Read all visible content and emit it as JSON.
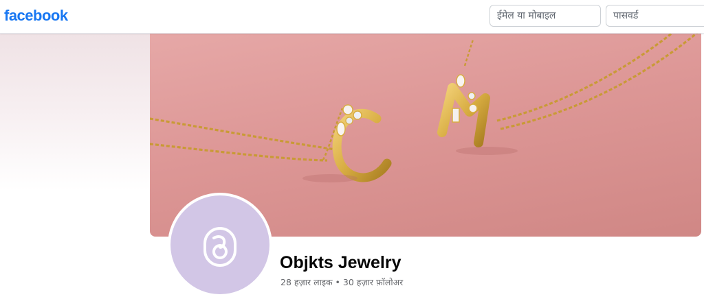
{
  "brand": {
    "logo_text": "facebook",
    "color": "#1877f2"
  },
  "login": {
    "email_placeholder": "ईमेल या मोबाइल",
    "password_placeholder": "पासवर्ड"
  },
  "cover": {
    "letters": [
      "C",
      "M"
    ],
    "background_color": "#dd9796",
    "metal_color": "#d8ad42"
  },
  "profile": {
    "name": "Objkts Jewelry",
    "stats": "28 हज़ार लाइक • 30 हज़ार फ़ॉलोअर",
    "avatar_color": "#d2c6e6",
    "avatar_icon": "objkts-logo-icon"
  }
}
